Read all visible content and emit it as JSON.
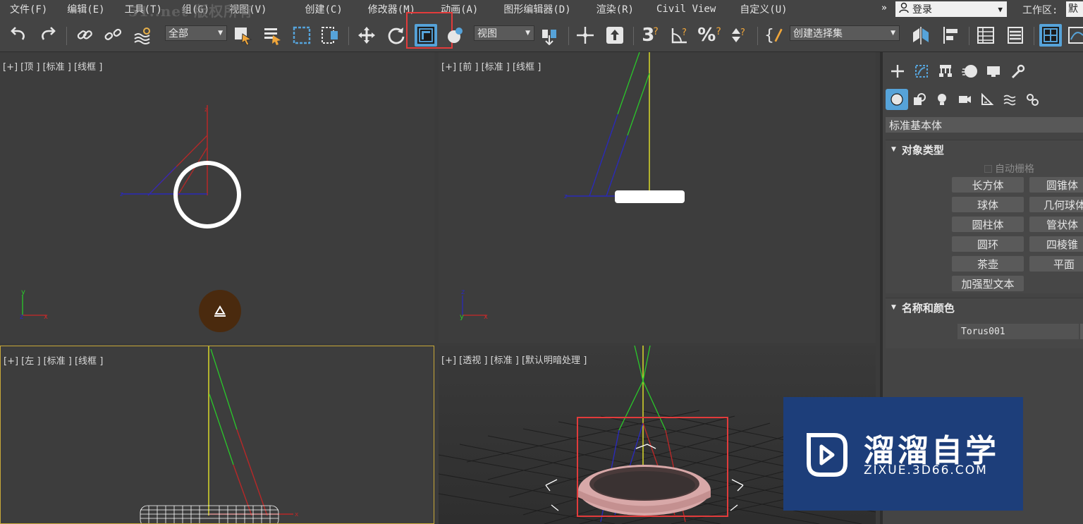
{
  "menubar": {
    "items": [
      "文件(F)",
      "编辑(E)",
      "工具(T)",
      "组(G)",
      "视图(V)",
      "创建(C)",
      "修改器(M)",
      "动画(A)",
      "图形编辑器(D)",
      "渲染(R)",
      "Civil View",
      "自定义(U)"
    ],
    "watermark": "51..net 版权所有",
    "more_symbol": "»",
    "login_label": "登录",
    "workspace_label": "工作区:",
    "workspace_value": "默"
  },
  "toolbar": {
    "selection_filter": "全部",
    "reference_coord": "视图",
    "named_selection": "创建选择集",
    "icons": [
      "undo-icon",
      "redo-icon",
      "link-icon",
      "unlink-icon",
      "bind-space-warp-icon",
      "select-object-icon",
      "select-by-name-icon",
      "rect-selection-region-icon",
      "window-crossing-icon",
      "move-icon",
      "rotate-icon",
      "scale-icon",
      "place-icon",
      "pivot-center-icon",
      "select-manipulate-icon",
      "keyboard-shortcut-override-icon",
      "snap-3d-icon",
      "angle-snap-icon",
      "percent-snap-icon",
      "spinner-snap-icon",
      "edit-named-selection-icon",
      "mirror-icon",
      "align-icon",
      "layer-explorer-icon",
      "toggle-ribbon-icon",
      "scene-explorer-icon",
      "curve-editor-icon"
    ],
    "highlighted_tool": "select-and-scale-icon"
  },
  "viewports": {
    "top": "[+] [顶 ] [标准 ] [线框 ]",
    "front": "[+] [前 ] [标准 ] [线框 ]",
    "left": "[+] [左 ] [标准 ] [线框 ]",
    "perspective": "[+] [透视 ] [标准 ] [默认明暗处理 ]"
  },
  "command_panel": {
    "tabs": [
      "create-tab",
      "modify-tab",
      "hierarchy-tab",
      "motion-tab",
      "display-tab",
      "utilities-tab"
    ],
    "subcategories": [
      "geometry-icon",
      "shapes-icon",
      "lights-icon",
      "cameras-icon",
      "helpers-icon",
      "space-warps-icon",
      "systems-icon"
    ],
    "category": "标准基本体",
    "object_type_title": "对象类型",
    "autogrid_label": "自动栅格",
    "object_buttons": [
      "长方体",
      "圆锥体",
      "球体",
      "几何球体",
      "圆柱体",
      "管状体",
      "圆环",
      "四棱锥",
      "茶壶",
      "平面",
      "加强型文本"
    ],
    "name_color_title": "名称和颜色",
    "object_name": "Torus001"
  },
  "logo": {
    "title": "溜溜自学",
    "url": "ZIXUE.3D66.COM"
  },
  "colors": {
    "ui_bg": "#444444",
    "viewport_bg": "#3d3d3d",
    "highlight": "#e23b3b",
    "active_blue": "#56a3d9",
    "logo_bg": "#1d3e7a"
  }
}
